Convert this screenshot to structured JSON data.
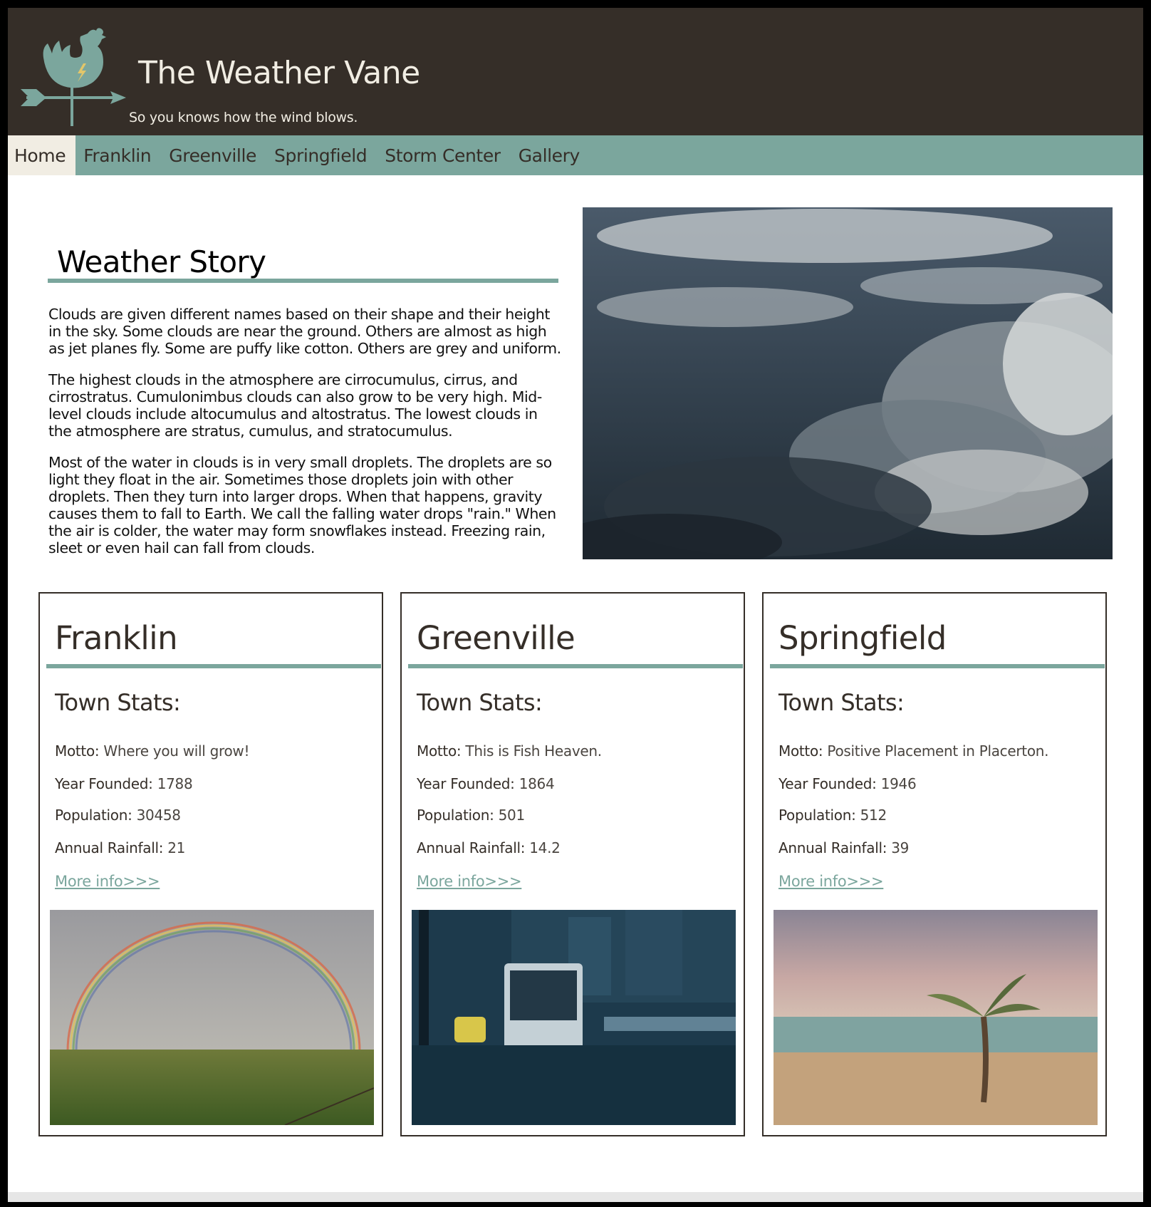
{
  "header": {
    "title": "The Weather Vane",
    "tagline": "So you knows how the wind blows."
  },
  "nav": {
    "items": [
      {
        "label": "Home",
        "active": true
      },
      {
        "label": "Franklin"
      },
      {
        "label": "Greenville"
      },
      {
        "label": "Springfield"
      },
      {
        "label": "Storm Center"
      },
      {
        "label": "Gallery"
      }
    ]
  },
  "story": {
    "heading": "Weather Story",
    "paragraphs": [
      "Clouds are given different names based on their shape and their height in the sky. Some clouds are near the ground. Others are almost as high as jet planes fly. Some are puffy like cotton. Others are grey and uniform.",
      "The highest clouds in the atmosphere are cirrocumulus, cirrus, and cirrostratus. Cumulonimbus clouds can also grow to be very high. Mid-level clouds include altocumulus and altostratus. The lowest clouds in the atmosphere are stratus, cumulus, and stratocumulus.",
      "Most of the water in clouds is in very small droplets. The droplets are so light they float in the air. Sometimes those droplets join with other droplets. Then they turn into larger drops. When that happens, gravity causes them to fall to Earth. We call the falling water drops \"rain.\" When the air is colder, the water may form snowflakes instead. Freezing rain, sleet or even hail can fall from clouds."
    ]
  },
  "towns": [
    {
      "name": "Franklin",
      "stats_heading": "Town Stats:",
      "motto_label": "Motto:",
      "motto": "Where you will grow!",
      "founded_label": "Year Founded:",
      "founded": "1788",
      "population_label": "Population:",
      "population": "30458",
      "rainfall_label": "Annual Rainfall:",
      "rainfall": "21",
      "link": "More info>>>"
    },
    {
      "name": "Greenville",
      "stats_heading": "Town Stats:",
      "motto_label": "Motto:",
      "motto": "This is Fish Heaven.",
      "founded_label": "Year Founded:",
      "founded": "1864",
      "population_label": "Population:",
      "population": "501",
      "rainfall_label": "Annual Rainfall:",
      "rainfall": "14.2",
      "link": "More info>>>"
    },
    {
      "name": "Springfield",
      "stats_heading": "Town Stats:",
      "motto_label": "Motto:",
      "motto": "Positive Placement in Placerton.",
      "founded_label": "Year Founded:",
      "founded": "1946",
      "population_label": "Population:",
      "population": "512",
      "rainfall_label": "Annual Rainfall:",
      "rainfall": "39",
      "link": "More info>>>"
    }
  ],
  "colors": {
    "header_bg": "#352e28",
    "accent": "#7ba69d",
    "active_tab": "#f1ede3"
  }
}
